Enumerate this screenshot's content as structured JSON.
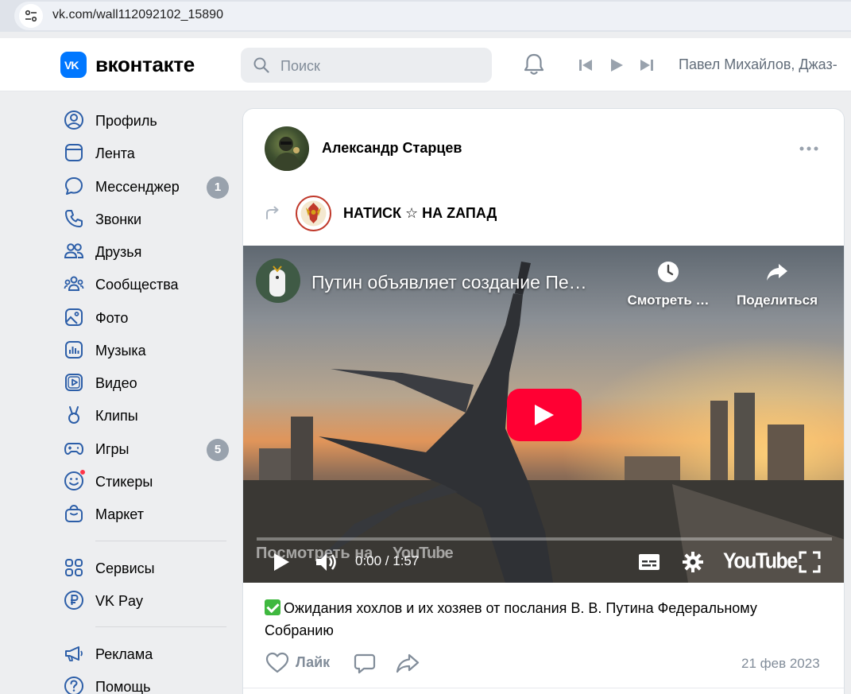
{
  "browser": {
    "url": "vk.com/wall112092102_15890"
  },
  "header": {
    "logo_text": "VK",
    "brand": "вконтакте",
    "search_placeholder": "Поиск",
    "now_playing": "Павел Михайлов, Джаз-"
  },
  "sidebar": {
    "items": [
      {
        "label": "Профиль",
        "icon": "user-circle-icon"
      },
      {
        "label": "Лента",
        "icon": "newsfeed-icon"
      },
      {
        "label": "Мессенджер",
        "icon": "message-icon",
        "badge": "1"
      },
      {
        "label": "Звонки",
        "icon": "phone-icon"
      },
      {
        "label": "Друзья",
        "icon": "friends-icon"
      },
      {
        "label": "Сообщества",
        "icon": "communities-icon"
      },
      {
        "label": "Фото",
        "icon": "photo-icon"
      },
      {
        "label": "Музыка",
        "icon": "music-icon"
      },
      {
        "label": "Видео",
        "icon": "video-icon"
      },
      {
        "label": "Клипы",
        "icon": "clips-icon"
      },
      {
        "label": "Игры",
        "icon": "gamepad-icon",
        "badge": "5"
      },
      {
        "label": "Стикеры",
        "icon": "sticker-icon",
        "dot": true
      },
      {
        "label": "Маркет",
        "icon": "market-bag-icon"
      }
    ],
    "secondary": [
      {
        "label": "Сервисы",
        "icon": "services-grid-icon"
      },
      {
        "label": "VK Pay",
        "icon": "vkpay-icon"
      }
    ],
    "tertiary": [
      {
        "label": "Реклама",
        "icon": "megaphone-icon"
      },
      {
        "label": "Помощь",
        "icon": "help-icon"
      }
    ]
  },
  "post": {
    "author": "Александр Старцев",
    "repost_source": "НАТИСК ☆ НА ZАПАД",
    "video": {
      "title": "Путин объявляет создание Пе…",
      "watch_later": "Смотреть …",
      "share": "Поделиться",
      "watch_on": "Посмотреть на",
      "watch_on_brand": "YouTube",
      "time": "0:00 / 1:57",
      "brand": "YouTube",
      "progress": 0
    },
    "text": "Ожидания хохлов и их хозяев от послания В. В. Путина Федеральному Собранию",
    "like_label": "Лайк",
    "date": "21 фев 2023"
  },
  "colors": {
    "accent": "#0077ff",
    "youtube_red": "#ff0033",
    "muted": "#818c99"
  }
}
